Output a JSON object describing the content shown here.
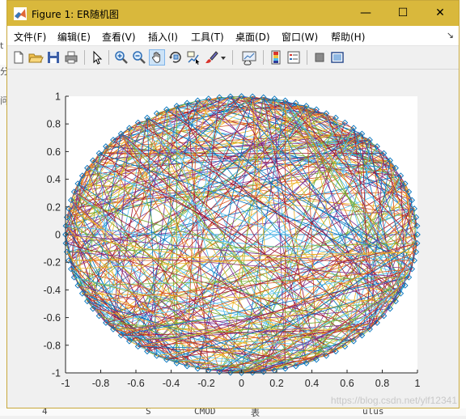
{
  "window": {
    "title": "Figure 1: ER随机图",
    "controls": {
      "minimize": "—",
      "maximize": "☐",
      "close": "✕"
    }
  },
  "menu": {
    "items": [
      {
        "label": "文件(F)",
        "name": "menu-file"
      },
      {
        "label": "编辑(E)",
        "name": "menu-edit"
      },
      {
        "label": "查看(V)",
        "name": "menu-view"
      },
      {
        "label": "插入(I)",
        "name": "menu-insert"
      },
      {
        "label": "工具(T)",
        "name": "menu-tools"
      },
      {
        "label": "桌面(D)",
        "name": "menu-desktop"
      },
      {
        "label": "窗口(W)",
        "name": "menu-window"
      },
      {
        "label": "帮助(H)",
        "name": "menu-help"
      }
    ],
    "overflow": "↘"
  },
  "toolbar": {
    "icons": [
      "new-figure-icon",
      "open-file-icon",
      "save-icon",
      "print-icon",
      "pointer-icon",
      "zoom-in-icon",
      "zoom-out-icon",
      "pan-hand-icon",
      "rotate-3d-icon",
      "data-cursor-icon",
      "brush-icon",
      "brush-dropdown-icon",
      "link-plot-icon",
      "insert-colorbar-icon",
      "insert-legend-icon",
      "hide-plot-tools-icon",
      "show-plot-tools-icon"
    ]
  },
  "chart_data": {
    "type": "scatter",
    "description_marker": "diamond",
    "node_count": 100,
    "title": "",
    "xlabel": "",
    "ylabel": "",
    "xlim": [
      -1,
      1
    ],
    "ylim": [
      -1,
      1
    ],
    "x_ticks": [
      "-1",
      "-0.8",
      "-0.6",
      "-0.4",
      "-0.2",
      "0",
      "0.2",
      "0.4",
      "0.6",
      "0.8",
      "1"
    ],
    "y_ticks": [
      "1",
      "0.8",
      "0.6",
      "0.4",
      "0.2",
      "0",
      "-0.2",
      "-0.4",
      "-0.6",
      "-0.8",
      "-1"
    ],
    "edge_probability": 0.1,
    "edge_colors": [
      "#0072BD",
      "#D95319",
      "#EDB120",
      "#7E2F8E",
      "#77AC30",
      "#4DBEEE",
      "#A2142F"
    ],
    "marker_color": "#0072BD",
    "grid": false
  },
  "watermark": "https://blog.csdn.net/ylf12341",
  "background_snippet": [
    "t",
    "分",
    "问"
  ],
  "background_bottom": [
    "4",
    "S",
    "CMOD",
    "表",
    "ulus"
  ]
}
